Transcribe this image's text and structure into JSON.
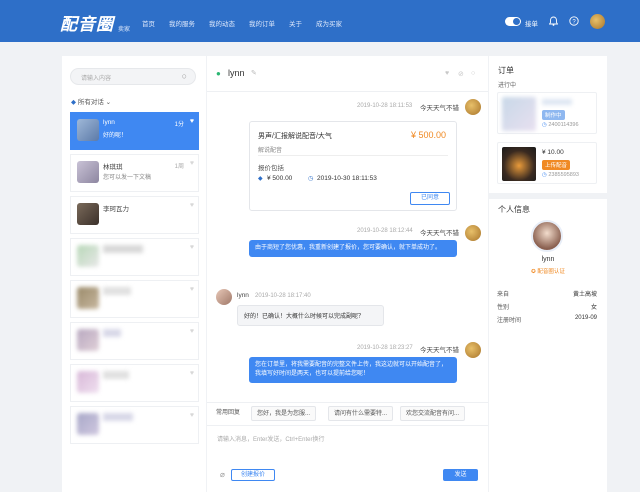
{
  "topbar": {
    "logo": "配音圈",
    "logo_sub": "卖家",
    "nav": [
      "首页",
      "我的服务",
      "我的动态",
      "我的订单",
      "关于",
      "成为买家"
    ],
    "toggle_label": "接单",
    "bell_icon": "bell-icon",
    "help_icon": "help-icon"
  },
  "sidebar": {
    "search_placeholder": "请输入内容",
    "filter_label": "所有对话",
    "items": [
      {
        "name": "lynn",
        "message": "好的呢！",
        "time": "1分",
        "active": true
      },
      {
        "name": "林琪琪",
        "message": "您可以发一下文稿",
        "time": "1周",
        "active": false
      },
      {
        "name": "李珂瓦力",
        "message": "",
        "time": "",
        "active": false
      },
      {
        "name": "",
        "message": "",
        "time": "",
        "active": false
      },
      {
        "name": "",
        "message": "",
        "time": "",
        "active": false
      },
      {
        "name": "",
        "message": "",
        "time": "",
        "active": false
      },
      {
        "name": "",
        "message": "",
        "time": "",
        "active": false
      },
      {
        "name": "",
        "message": "",
        "time": "",
        "active": false
      }
    ]
  },
  "chat": {
    "contact": "lynn",
    "messages": [
      {
        "time": "2019-10-28 18:11:53",
        "sender": "今天天气不错"
      },
      {
        "time": "2019-10-28 18:12:44",
        "sender": "今天天气不错",
        "text": "由于商短了您优惠，我重新创建了报价，您可要确认，就下单成功了。"
      },
      {
        "time": "2019-10-28 18:17:40",
        "sender": "lynn",
        "text": "好的！已确认！大概什么时候可以完成副呢？"
      },
      {
        "time": "2019-10-28 18:23:27",
        "sender": "今天天气不错",
        "text": "您在订单里，将我需要配音的完整文件上传，我这边就可以开始配音了，我填写好时间是两天，也可以提前给您呢！"
      }
    ],
    "card": {
      "title": "男声/汇报解说配音/大气",
      "price": "¥ 500.00",
      "subtitle": "解说配音",
      "offer_label": "报价包括",
      "offer_price": "¥ 500.00",
      "offer_date": "2019-10-30 18:11:53",
      "button": "已同意"
    },
    "quick_replies_label": "常用回复",
    "quick_replies": [
      "您好，我是为您服...",
      "请问有什么需要特...",
      "欢您交流配音有问..."
    ],
    "input_placeholder": "请输入消息，Enter发送，Ctrl+Enter换行",
    "create_offer": "创建报价",
    "send": "发送"
  },
  "orders": {
    "title": "订单",
    "status": "进行中",
    "items": [
      {
        "price": "",
        "tag": "制作中",
        "number": "2400114396"
      },
      {
        "price": "¥ 10.00",
        "tag": "上传配音",
        "number": "2385595893"
      }
    ]
  },
  "profile": {
    "title": "个人信息",
    "name": "lynn",
    "badge": "配音圈认证",
    "rows": [
      {
        "label": "来自",
        "value": "黄土高坡"
      },
      {
        "label": "性别",
        "value": "女"
      },
      {
        "label": "注册时间",
        "value": "2019-09"
      }
    ]
  }
}
